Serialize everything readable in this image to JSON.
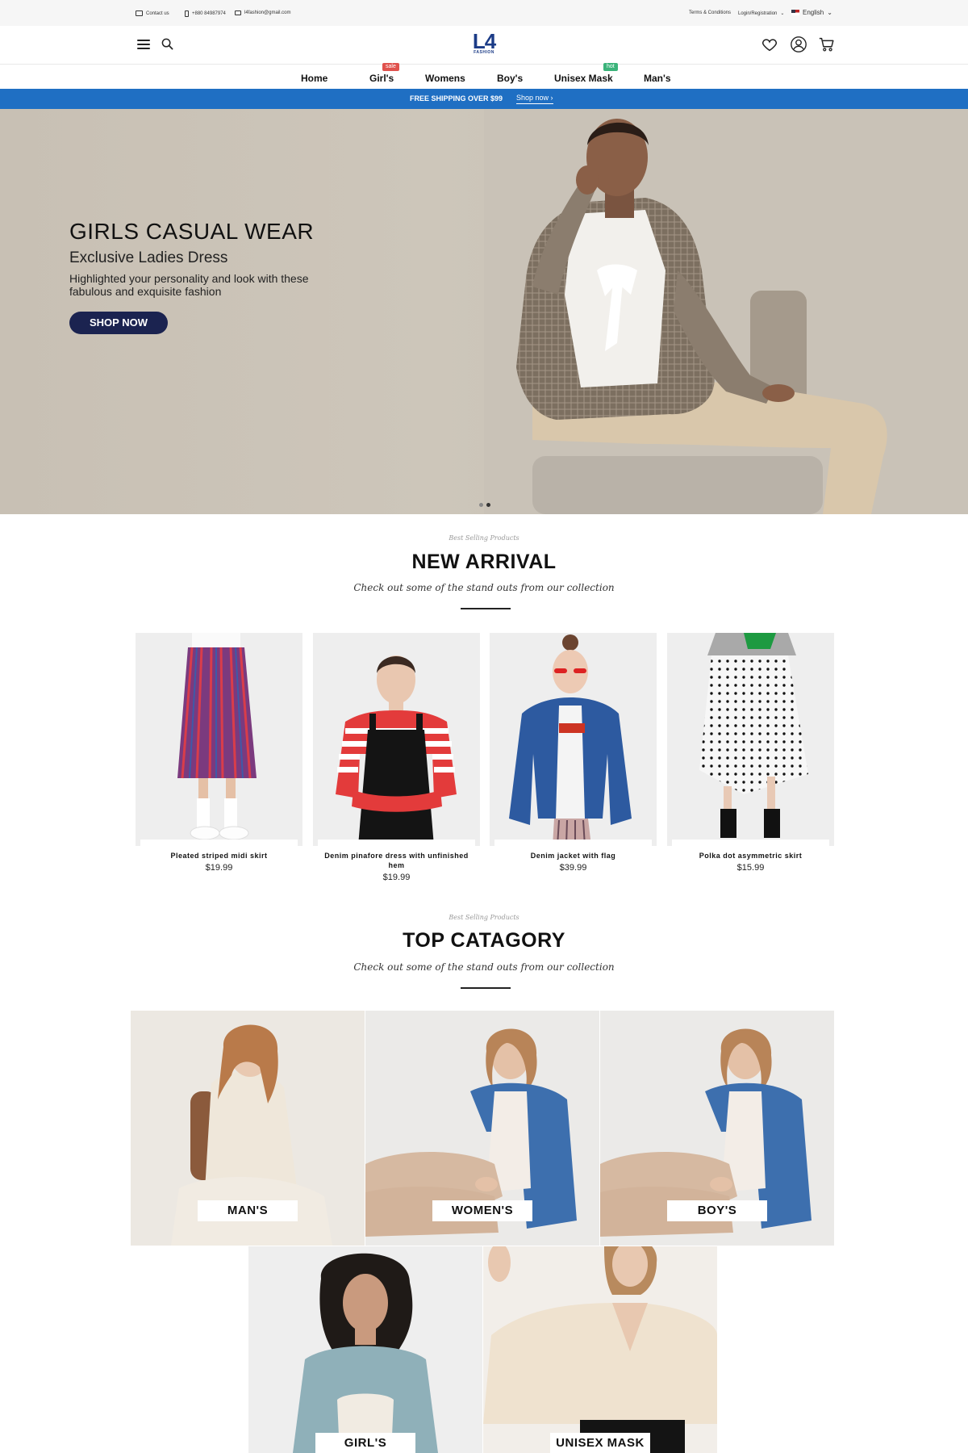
{
  "topbar": {
    "contact": "Contact us",
    "phone": "+880 84987974",
    "email": "l4fashion@gmail.com",
    "terms": "Terms & Conditions",
    "login": "Login/Registration",
    "language": "English"
  },
  "header": {
    "logo_main": "L4",
    "logo_sub": "FASHION"
  },
  "nav": {
    "items": [
      {
        "label": "Home"
      },
      {
        "label": "Girl's",
        "badge": "sale"
      },
      {
        "label": "Womens"
      },
      {
        "label": "Boy's"
      },
      {
        "label": "Unisex Mask",
        "badge": "hot"
      },
      {
        "label": "Man's"
      }
    ]
  },
  "shipping": {
    "text": "FREE SHIPPING OVER $99",
    "link": "Shop now"
  },
  "hero": {
    "title": "GIRLS CASUAL WEAR",
    "subtitle": "Exclusive Ladies Dress",
    "description": "Highlighted your personality and look with these fabulous and exquisite fashion",
    "button": "SHOP NOW"
  },
  "new_arrival": {
    "kicker": "Best Selling Products",
    "title": "NEW ARRIVAL",
    "subtitle": "Check out some of the stand outs from our collection",
    "products": [
      {
        "name": "Pleated striped midi skirt",
        "price": "$19.99"
      },
      {
        "name": "Denim pinafore dress with unfinished hem",
        "price": "$19.99"
      },
      {
        "name": "Denim jacket with flag",
        "price": "$39.99"
      },
      {
        "name": "Polka dot asymmetric skirt",
        "price": "$15.99"
      }
    ]
  },
  "top_category": {
    "kicker": "Best Selling Products",
    "title": "TOP CATAGORY",
    "subtitle": "Check out some of the stand outs from our collection",
    "categories": [
      {
        "label": "MAN'S"
      },
      {
        "label": "WOMEN'S"
      },
      {
        "label": "BOY'S"
      },
      {
        "label": "GIRL'S"
      },
      {
        "label": "UNISEX MASK"
      }
    ]
  },
  "colors": {
    "shipping_bar": "#1f6fc3",
    "logo": "#1c3c87",
    "shop_button": "#1b2350",
    "sale_badge": "#e0524d",
    "hot_badge": "#3bb37a"
  }
}
